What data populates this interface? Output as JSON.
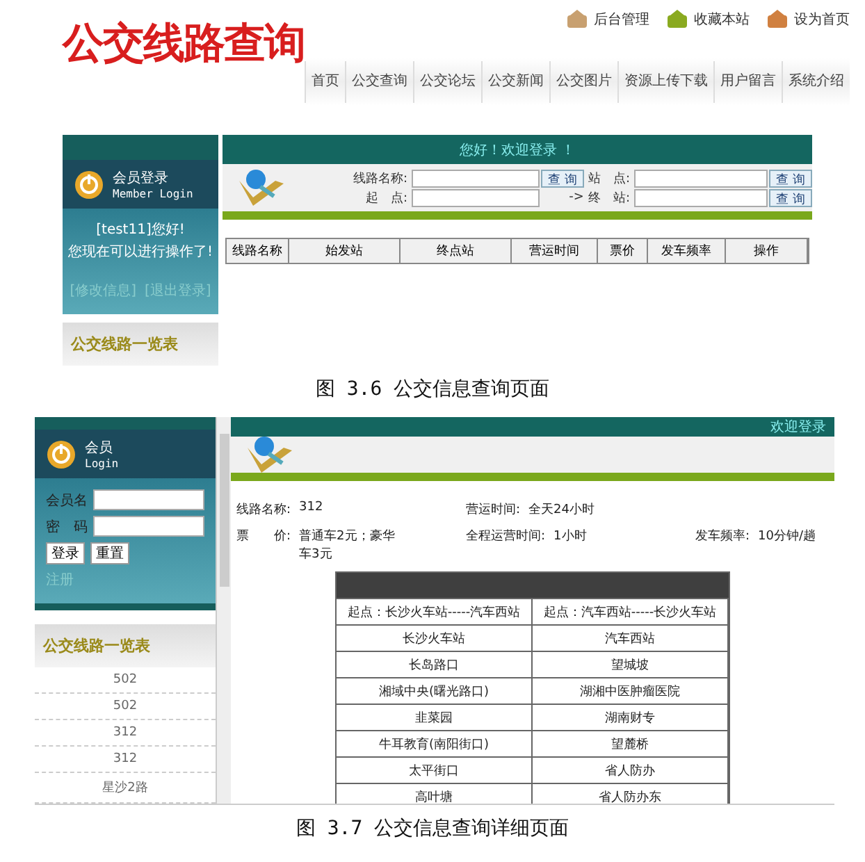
{
  "figure_1": {
    "logo": "公交线路查询",
    "top_links": [
      "后台管理",
      "收藏本站",
      "设为首页"
    ],
    "nav": [
      "首页",
      "公交查询",
      "公交论坛",
      "公交新闻",
      "公交图片",
      "资源上传下载",
      "用户留言",
      "系统介绍"
    ],
    "member": {
      "title": "会员登录",
      "subtitle": "Member Login",
      "greeting": "[test11]您好!",
      "message": "您现在可以进行操作了!",
      "links": [
        "[修改信息]",
        "[退出登录]"
      ]
    },
    "route_list_title": "公交线路一览表",
    "welcome": "您好！欢迎登录 ！",
    "search": {
      "line_label": "线路名称:",
      "start_label": "起　点:",
      "arrow": "->",
      "stop_label": "站　点:",
      "end_label": "终　站:",
      "buttons": [
        "查 询",
        "查 询",
        "查 询"
      ]
    },
    "table": {
      "columns": [
        "线路名称",
        "始发站",
        "终点站",
        "营运时间",
        "票价",
        "发车频率",
        "操作"
      ]
    },
    "caption": "图 3.6 公交信息查询页面"
  },
  "figure_2": {
    "member": {
      "title": "会员",
      "subtitle": "Login",
      "username_label": "会员名",
      "password_label": "密　码",
      "buttons": [
        "登录",
        "重置"
      ],
      "register": "注册"
    },
    "route_list_title": "公交线路一览表",
    "routes": [
      "502",
      "502",
      "312",
      "312",
      "星沙2路"
    ],
    "welcome": "欢迎登录",
    "info": [
      {
        "label": "线路名称:",
        "value": "312"
      },
      {
        "label": "营运时间:",
        "value": "全天24小时"
      },
      {
        "label": "票　　价:",
        "value": "普通车2元；豪华车3元"
      },
      {
        "label": "全程运营时间:",
        "value": "1小时"
      },
      {
        "label": "发车频率:",
        "value": "10分钟/趟"
      }
    ],
    "stops_table": {
      "directions": [
        "起点：长沙火车站-----汽车西站",
        "起点：汽车西站-----长沙火车站"
      ],
      "rows": [
        [
          "长沙火车站",
          "汽车西站"
        ],
        [
          "长岛路口",
          "望城坡"
        ],
        [
          "湘域中央(曙光路口)",
          "湖湘中医肿瘤医院"
        ],
        [
          "韭菜园",
          "湖南财专"
        ],
        [
          "牛耳教育(南阳街口)",
          "望麓桥"
        ],
        [
          "太平街口",
          "省人防办"
        ],
        [
          "高叶塘",
          "省人防办东"
        ]
      ]
    },
    "caption": "图 3.7 公交信息查询详细页面"
  }
}
